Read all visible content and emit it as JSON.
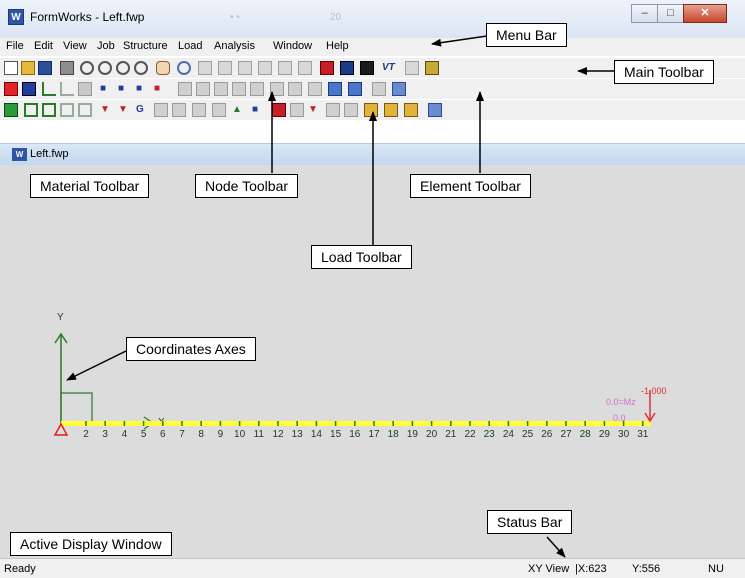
{
  "window": {
    "title": "FormWorks - Left.fwp",
    "ghost_title_left": "• •",
    "ghost_title_right": "20"
  },
  "menu": [
    {
      "id": "file",
      "label": "File"
    },
    {
      "id": "edit",
      "label": "Edit"
    },
    {
      "id": "view",
      "label": "View"
    },
    {
      "id": "job",
      "label": "Job"
    },
    {
      "id": "structure",
      "label": "Structure"
    },
    {
      "id": "load",
      "label": "Load"
    },
    {
      "id": "analysis",
      "label": "Analysis"
    },
    {
      "id": "window",
      "label": "Window"
    },
    {
      "id": "help",
      "label": "Help"
    }
  ],
  "document": {
    "tab_title": "Left.fwp"
  },
  "canvas": {
    "y_axis_label": "Y",
    "x_axis_label": "X",
    "node_labels": [
      "2",
      "3",
      "4",
      "5",
      "6",
      "7",
      "8",
      "9",
      "10",
      "11",
      "12",
      "13",
      "14",
      "15",
      "16",
      "17",
      "18",
      "19",
      "20",
      "21",
      "22",
      "23",
      "24",
      "25",
      "26",
      "27",
      "28",
      "29",
      "30",
      "31"
    ],
    "load_value": "-1.000",
    "moment_label": "0.0=Mz",
    "zero_label": "0.0"
  },
  "status": {
    "ready": "Ready",
    "view": "XY View",
    "x": "|X:623",
    "y": "Y:556",
    "mode": "NU"
  },
  "callouts": {
    "menu_bar": "Menu Bar",
    "main_toolbar": "Main Toolbar",
    "material_toolbar": "Material Toolbar",
    "node_toolbar": "Node Toolbar",
    "element_toolbar": "Element Toolbar",
    "load_toolbar": "Load Toolbar",
    "coordinates_axes": "Coordinates Axes",
    "status_bar": "Status Bar",
    "active_display_window": "Active Display Window"
  },
  "colors": {
    "beam": "#ffff3c",
    "axis": "#2a7a2a",
    "support": "#e02020",
    "load": "#e03030",
    "label_magenta": "#d46bd6",
    "app_icon": "#2f56a5"
  },
  "toolbars": {
    "main": [
      "new-icon",
      "open-icon",
      "save-icon",
      "print-icon",
      "zoom-window-icon",
      "zoom-in-icon",
      "zoom-out-icon",
      "zoom-all-icon",
      "pan-icon",
      "redraw-icon",
      "view-xy-icon",
      "view-zy-icon",
      "view-xz-icon",
      "view-up-icon",
      "view-down-icon",
      "view-3d-icon",
      "save-red-icon",
      "save-blue-icon",
      "save-black-icon",
      "vt-icon",
      "grid-icon",
      "book-icon"
    ],
    "material": [
      "material-j-icon",
      "material-s-icon",
      "material-edit-icon",
      "material-delete-icon",
      "material-list-icon"
    ],
    "node": [
      "node-add-icon",
      "node-move-icon",
      "node-support-icon",
      "node-delete-icon"
    ],
    "element": [
      "element-add-icon",
      "element-diag-icon",
      "element-copy-icon",
      "element-split-icon",
      "element-release-icon",
      "element-offset-icon",
      "element-list-icon",
      "element-grid-icon",
      "element-frame-icon",
      "element-section-icon",
      "element-prop-icon",
      "element-edit-icon"
    ],
    "load": [
      "load-case-icon",
      "load-combo-icon",
      "load-g1-icon",
      "load-g2-icon",
      "load-g3-icon",
      "load-node-icon",
      "load-dist-icon",
      "load-g-icon",
      "load-temp-icon",
      "load-eccentric-icon",
      "load-pattern-icon",
      "load-area-icon",
      "load-point-icon",
      "load-fr-icon",
      "load-bars-icon",
      "load-t-icon",
      "load-y-icon",
      "load-list-icon",
      "load-view-icon",
      "load-r1-icon",
      "load-r2-icon",
      "load-r3-icon",
      "load-edit-icon"
    ]
  }
}
